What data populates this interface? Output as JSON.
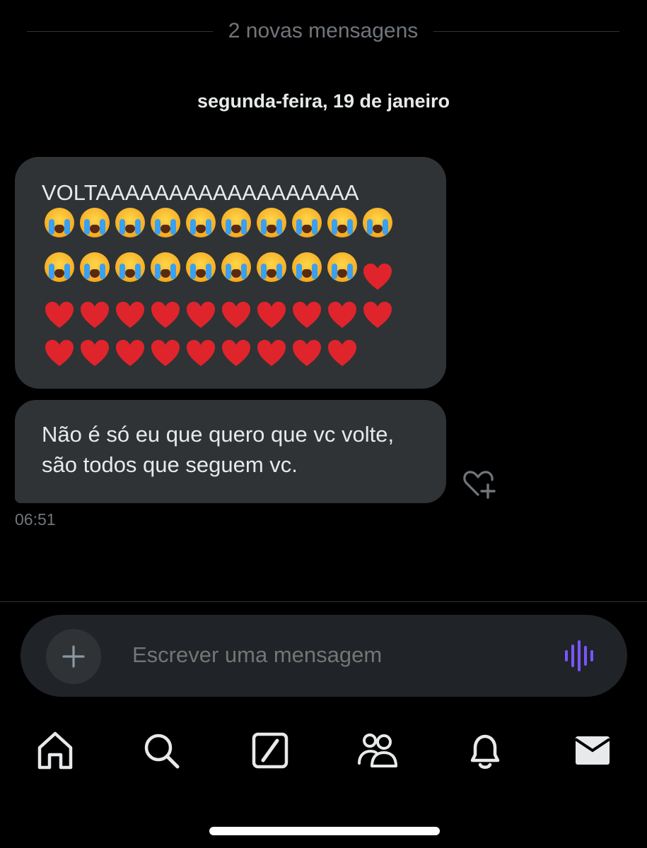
{
  "conversation": {
    "new_messages_label": "2 novas mensagens",
    "date_label": "segunda-feira, 19 de janeiro",
    "messages": [
      {
        "text": "VOLTAAAAAAAAAAAAAAAAAA",
        "emojis": [
          "loudly-crying-face",
          "loudly-crying-face",
          "loudly-crying-face",
          "loudly-crying-face",
          "loudly-crying-face",
          "loudly-crying-face",
          "loudly-crying-face",
          "loudly-crying-face",
          "loudly-crying-face",
          "loudly-crying-face",
          "loudly-crying-face",
          "loudly-crying-face",
          "loudly-crying-face",
          "loudly-crying-face",
          "loudly-crying-face",
          "loudly-crying-face",
          "loudly-crying-face",
          "loudly-crying-face",
          "loudly-crying-face",
          "red-heart",
          "red-heart",
          "red-heart",
          "red-heart",
          "red-heart",
          "red-heart",
          "red-heart",
          "red-heart",
          "red-heart",
          "red-heart",
          "red-heart",
          "red-heart",
          "red-heart",
          "red-heart",
          "red-heart",
          "red-heart",
          "red-heart",
          "red-heart",
          "red-heart",
          "red-heart"
        ]
      },
      {
        "text": "Não é só eu que quero que vc volte, são todos que seguem vc."
      }
    ],
    "timestamp": "06:51"
  },
  "composer": {
    "placeholder": "Escrever uma mensagem",
    "add_icon": "plus-icon",
    "voice_icon": "voice-waveform-icon",
    "accent_color": "#7856ff"
  },
  "nav": {
    "items": [
      "home-icon",
      "search-icon",
      "grok-icon",
      "communities-icon",
      "notifications-icon",
      "messages-icon"
    ]
  },
  "colors": {
    "background": "#000000",
    "bubble": "#2f3336",
    "muted_text": "#71767b",
    "heart": "#e0242b"
  }
}
